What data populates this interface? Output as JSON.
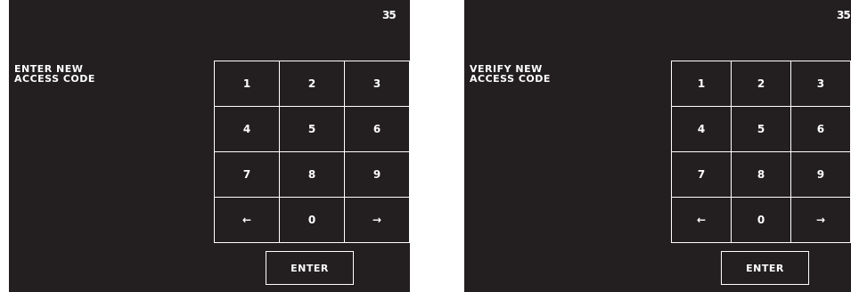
{
  "screens": [
    {
      "page_number": "35",
      "prompt_line1": "ENTER NEW",
      "prompt_line2": "ACCESS CODE",
      "keys": [
        "1",
        "2",
        "3",
        "4",
        "5",
        "6",
        "7",
        "8",
        "9",
        "←",
        "0",
        "→"
      ],
      "enter_label": "ENTER"
    },
    {
      "page_number": "35",
      "prompt_line1": "VERIFY NEW",
      "prompt_line2": "ACCESS CODE",
      "keys": [
        "1",
        "2",
        "3",
        "4",
        "5",
        "6",
        "7",
        "8",
        "9",
        "←",
        "0",
        "→"
      ],
      "enter_label": "ENTER"
    }
  ]
}
